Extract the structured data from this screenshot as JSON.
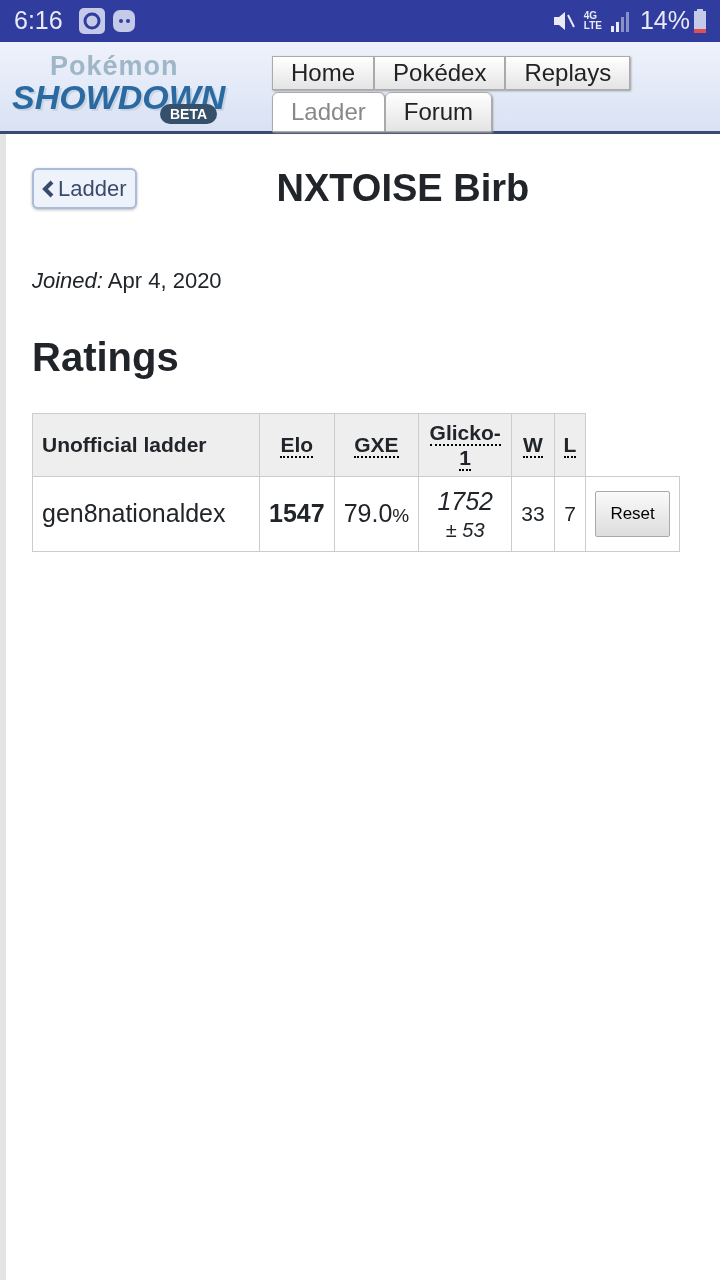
{
  "status_bar": {
    "time": "6:16",
    "network": "4G",
    "network_sub": "LTE",
    "battery": "14%"
  },
  "header": {
    "logo": {
      "top": "Pokémon",
      "main": "SHOWDOWN",
      "badge": "BETA"
    },
    "tab_rows": [
      [
        {
          "label": "Home",
          "selected": false
        },
        {
          "label": "Pokédex",
          "selected": false
        },
        {
          "label": "Replays",
          "selected": false
        }
      ],
      [
        {
          "label": "Ladder",
          "selected": true
        },
        {
          "label": "Forum",
          "selected": false
        }
      ]
    ]
  },
  "back_button": {
    "label": "Ladder"
  },
  "title": "NXTOISE Birb",
  "joined": {
    "label": "Joined:",
    "value": "Apr 4, 2020"
  },
  "ratings": {
    "heading": "Ratings",
    "columns": [
      {
        "label": "Unofficial ladder",
        "abbr": false
      },
      {
        "label": "Elo",
        "abbr": true
      },
      {
        "label": "GXE",
        "abbr": true
      },
      {
        "label": "Glicko-1",
        "abbr": true
      },
      {
        "label": "W",
        "abbr": true
      },
      {
        "label": "L",
        "abbr": true
      }
    ],
    "rows": [
      {
        "format": "gen8nationaldex",
        "elo": "1547",
        "gxe": "79.0",
        "gxe_unit": "%",
        "glicko": "1752",
        "glicko_dev": "± 53",
        "w": "33",
        "l": "7",
        "action": "Reset"
      }
    ]
  }
}
